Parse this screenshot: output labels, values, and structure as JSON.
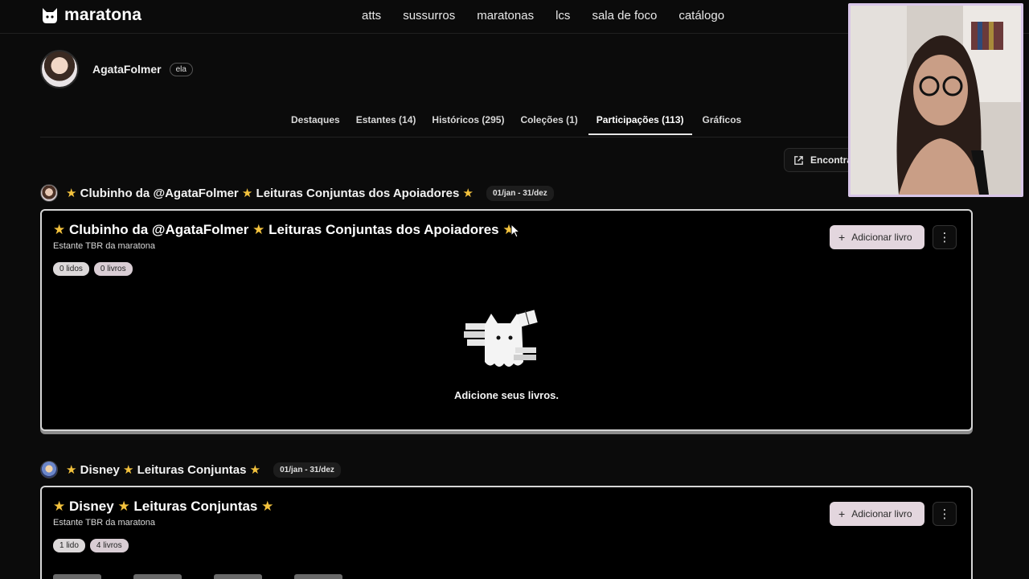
{
  "brand": {
    "name": "maratona"
  },
  "nav": [
    "atts",
    "sussurros",
    "maratonas",
    "lcs",
    "sala de foco",
    "catálogo"
  ],
  "profile": {
    "username": "AgataFolmer",
    "pronoun": "ela"
  },
  "tabs": [
    "Destaques",
    "Estantes (14)",
    "Históricos (295)",
    "Coleções (1)",
    "Participações (113)",
    "Gráficos"
  ],
  "active_tab": "Participações (113)",
  "encontra_label": "Encontra",
  "sections": [
    {
      "title": "★ Clubinho da @AgataFolmer ★ Leituras Conjuntas dos Apoiadores ★",
      "date": "01/jan - 31/dez",
      "card_title": "★ Clubinho da @AgataFolmer ★ Leituras Conjuntas dos Apoiadores ★",
      "card_sub": "Estante TBR da maratona",
      "pills": [
        "0 lidos",
        "0 livros"
      ],
      "add_label": "Adicionar livro",
      "empty_text": "Adicione seus livros."
    },
    {
      "title": "★ Disney ★ Leituras Conjuntas ★",
      "date": "01/jan - 31/dez",
      "card_title": "★ Disney ★ Leituras Conjuntas ★",
      "card_sub": "Estante TBR da maratona",
      "pills": [
        "1 lido",
        "4 livros"
      ],
      "add_label": "Adicionar livro"
    }
  ],
  "colors": {
    "star": "#f3c23d",
    "accent_button": "#e3d6de",
    "webcam_border": "#d8c6e8"
  }
}
